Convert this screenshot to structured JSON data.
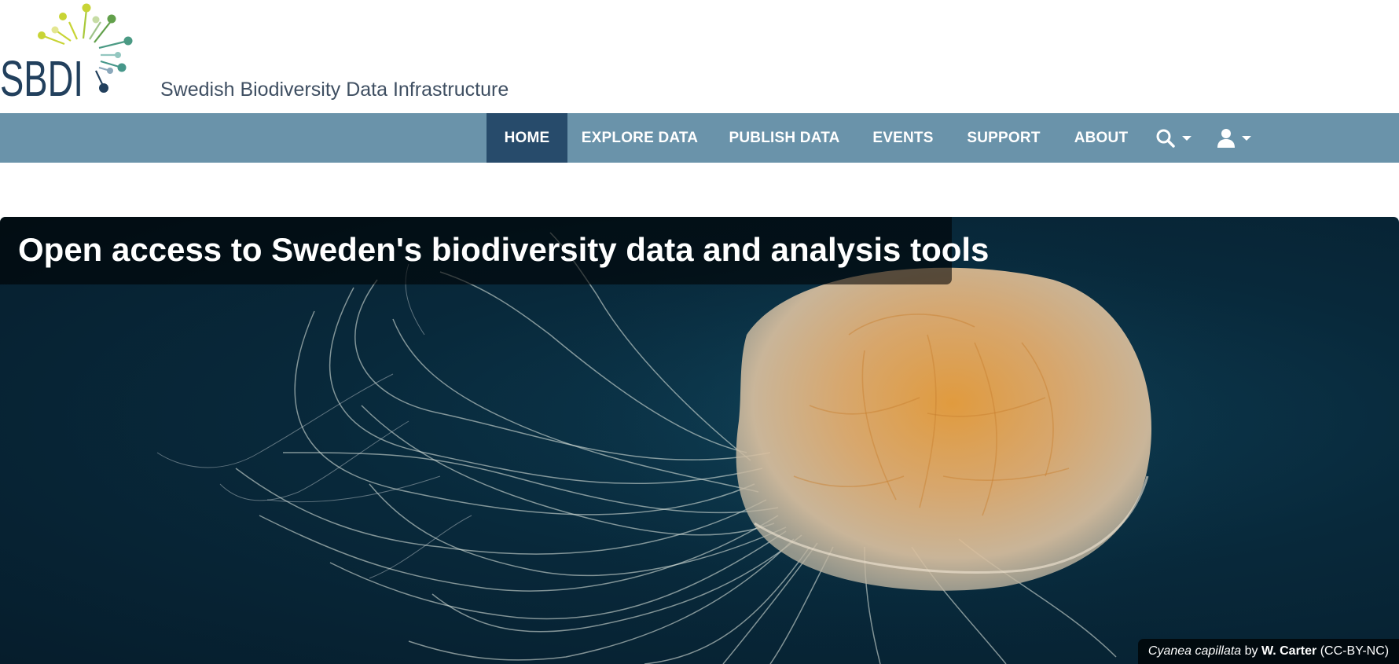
{
  "brand": {
    "logo_text": "SBDI",
    "tagline": "Swedish Biodiversity Data Infrastructure"
  },
  "nav": {
    "items": [
      {
        "label": "HOME",
        "active": true
      },
      {
        "label": "EXPLORE DATA",
        "active": false
      },
      {
        "label": "PUBLISH DATA",
        "active": false
      },
      {
        "label": "EVENTS",
        "active": false
      },
      {
        "label": "SUPPORT",
        "active": false
      },
      {
        "label": "ABOUT",
        "active": false
      }
    ],
    "search_icon": "search-icon",
    "user_icon": "user-icon"
  },
  "hero": {
    "title": "Open access to Sweden's biodiversity data and analysis tools",
    "credit": {
      "species": "Cyanea capillata",
      "by": "by",
      "author": "W. Carter",
      "license": "(CC-BY-NC)"
    }
  },
  "colors": {
    "navbar": "#6a93aa",
    "nav_active": "#274b6b",
    "brand_dark": "#22405d",
    "hero_water": "#08293b"
  }
}
